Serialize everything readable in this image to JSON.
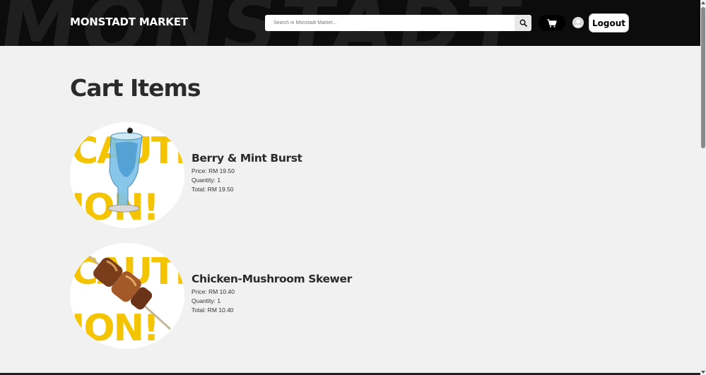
{
  "header": {
    "brand": "MONSTADT MARKET",
    "search_placeholder": "Search in Monstadt Market...",
    "logout_label": "Logout",
    "bg_color": "#0c0c0c"
  },
  "icons": {
    "search": "search-icon",
    "cart": "cart-icon",
    "avatar": "user-avatar-icon"
  },
  "main": {
    "title": "Cart Items",
    "items": [
      {
        "name": "Berry & Mint Burst",
        "price": "Price: RM 19.50",
        "quantity": "Quantity: 1",
        "total": "Total: RM 19.50",
        "image": "blue-drink-glass"
      },
      {
        "name": "Chicken-Mushroom Skewer",
        "price": "Price: RM 10.40",
        "quantity": "Quantity: 1",
        "total": "Total: RM 10.40",
        "image": "skewer"
      }
    ]
  },
  "image_overlay_text": [
    "CAUTI",
    "ION!"
  ],
  "colors": {
    "accent_yellow": "#f5c400",
    "page_bg": "#f1f1f1",
    "title_text": "#2b2b2b"
  }
}
